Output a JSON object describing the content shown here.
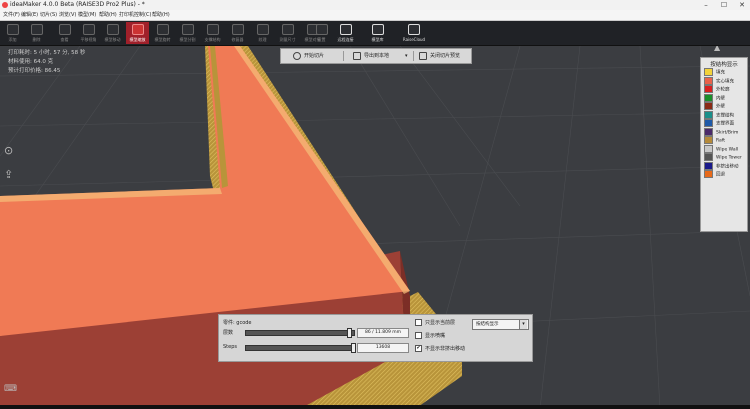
{
  "window": {
    "title": "ideaMaker 4.0.0 Beta (RAISE3D Pro2 Plus) - *",
    "controls": [
      "–",
      "☐",
      "✕"
    ]
  },
  "menu": [
    "文件(F)",
    "编辑(E)",
    "切片(S)",
    "浏览(V)",
    "模型(M)",
    "帮助(H)",
    "打印机控制(C)",
    "帮助(H)"
  ],
  "toolbar": {
    "items": [
      {
        "label": "添加"
      },
      {
        "label": "删除"
      },
      {
        "label": "查看"
      },
      {
        "label": "平移视角"
      },
      {
        "label": "模型移动"
      },
      {
        "label": "模型缩放"
      },
      {
        "label": "模型旋转"
      },
      {
        "label": "模型分割"
      },
      {
        "label": "支撑结构"
      },
      {
        "label": "修复器"
      },
      {
        "label": "纹理"
      },
      {
        "label": "测量尺寸"
      },
      {
        "label": "模型对接"
      },
      {
        "label": "设置"
      },
      {
        "label": "远程连接"
      },
      {
        "label": "模型库"
      },
      {
        "label": "RaiseCloud"
      }
    ],
    "active_index": 4
  },
  "info": {
    "time": "打印耗时: 5 小时, 57 分, 58 秒",
    "material": "材料使用: 64.0 克",
    "cost": "预计打印价格: 86.45"
  },
  "slicebar": {
    "start": "开始切片",
    "export": "导出到本地",
    "close": "关闭切片预览"
  },
  "legend": {
    "title": "按结构显示",
    "items": [
      {
        "label": "填充",
        "color": "#f2d23a"
      },
      {
        "label": "实心填充",
        "color": "#e8624a"
      },
      {
        "label": "外轮廓",
        "color": "#d92020"
      },
      {
        "label": "内壁",
        "color": "#1a8f2a"
      },
      {
        "label": "外壁",
        "color": "#8a2a16"
      },
      {
        "label": "支撑结构",
        "color": "#1a8f8a"
      },
      {
        "label": "支撑界面",
        "color": "#1f5aa8"
      },
      {
        "label": "Skirt/Brim",
        "color": "#4a2a6a"
      },
      {
        "label": "Raft",
        "color": "#b58a3a"
      },
      {
        "label": "Wipe Wall",
        "color": "#c8c8c8"
      },
      {
        "label": "Wipe Tower",
        "color": "#555555"
      },
      {
        "label": "非挤出移动",
        "color": "#1a1a8a"
      },
      {
        "label": "回退",
        "color": "#e86a1a"
      }
    ]
  },
  "bottom": {
    "file": "零件: gcode",
    "layer_label": "层数",
    "layer_value": "86 / 11.809 mm",
    "steps_label": "Steps",
    "steps_value": "13608",
    "layer_fraction": 0.96,
    "steps_fraction": 1.0,
    "only_current": "只显示当前层",
    "show_nozzle": "显示喷嘴",
    "hide_travel": "不显示非挤出移动",
    "hide_travel_checked": true,
    "display_mode": "按结构显示"
  }
}
